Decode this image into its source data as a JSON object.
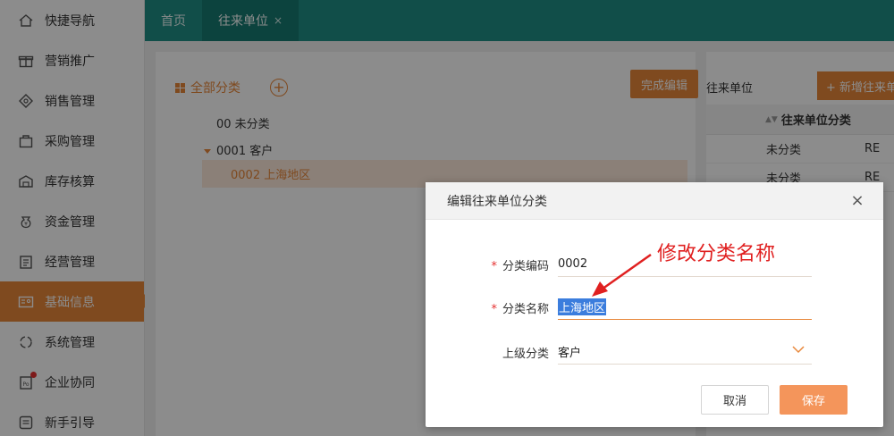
{
  "sidebar": {
    "items": [
      {
        "label": "快捷导航",
        "icon": "home-icon"
      },
      {
        "label": "营销推广",
        "icon": "gift-icon"
      },
      {
        "label": "销售管理",
        "icon": "tag-icon"
      },
      {
        "label": "采购管理",
        "icon": "bag-icon"
      },
      {
        "label": "库存核算",
        "icon": "warehouse-icon"
      },
      {
        "label": "资金管理",
        "icon": "money-icon"
      },
      {
        "label": "经营管理",
        "icon": "clipboard-icon"
      },
      {
        "label": "基础信息",
        "icon": "id-card-icon",
        "active": true
      },
      {
        "label": "系统管理",
        "icon": "cycle-icon"
      },
      {
        "label": "企业协同",
        "icon": "document-icon",
        "badge": true
      },
      {
        "label": "新手引导",
        "icon": "guide-icon"
      }
    ]
  },
  "tabs": [
    {
      "label": "首页"
    },
    {
      "label": "往来单位",
      "close": "×",
      "active": true
    }
  ],
  "category": {
    "header": "全部分类",
    "add_symbol": "+",
    "done_button": "完成编辑",
    "tree": [
      {
        "label": "00 未分类"
      },
      {
        "label": "0001 客户"
      },
      {
        "label": "0002 上海地区"
      }
    ]
  },
  "right_panel": {
    "title": "往来单位",
    "new_button": "+ 新增往来单位",
    "table_header": "往来单位分类",
    "table_header_rest": "",
    "rows": [
      {
        "c1": "未分类",
        "c2": "RE"
      },
      {
        "c1": "未分类",
        "c2": "RE"
      }
    ]
  },
  "dialog": {
    "title": "编辑往来单位分类",
    "close": "×",
    "fields": {
      "code_label": "分类编码",
      "code_value": "0002",
      "name_label": "分类名称",
      "name_value": "上海地区",
      "parent_label": "上级分类",
      "parent_value": "客户"
    },
    "required_mark": "*",
    "cancel": "取消",
    "save": "保存"
  },
  "annotation": {
    "text": "修改分类名称"
  },
  "colors": {
    "accent": "#e8873a",
    "topbar": "#1f8f86",
    "annotation": "#e02020"
  }
}
